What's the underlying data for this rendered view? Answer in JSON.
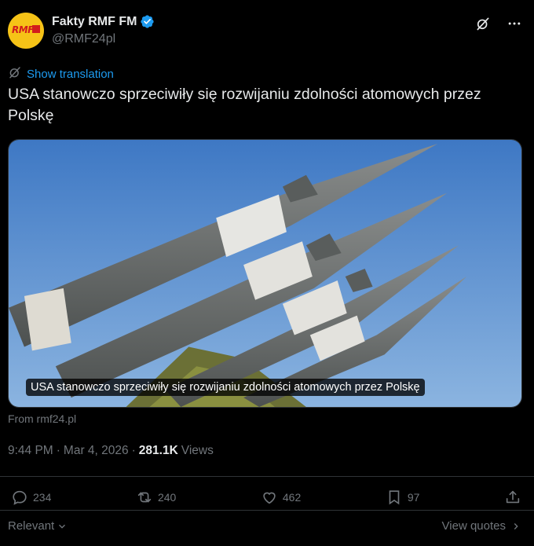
{
  "author": {
    "name": "Fakty RMF FM",
    "handle": "@RMF24pl",
    "avatar_text": "RMF"
  },
  "translate": {
    "label": "Show translation"
  },
  "tweet": {
    "text": "USA stanowczo sprzeciwiły się rozwijaniu zdolności atomowych przez Polskę"
  },
  "media": {
    "caption": "USA stanowczo sprzeciwiły się rozwijaniu zdolności atomowych przez Polskę"
  },
  "source": "From rmf24.pl",
  "meta": {
    "time": "9:44 PM",
    "separator": "·",
    "date": "Mar 4, 2026",
    "views_count": "281.1K",
    "views_label": "Views"
  },
  "actions": {
    "replies": "234",
    "reposts": "240",
    "likes": "462",
    "bookmarks": "97"
  },
  "footer": {
    "relevant": "Relevant",
    "view_quotes": "View quotes"
  },
  "colors": {
    "background": "#000000",
    "text": "#e7e9ea",
    "muted": "#71767b",
    "link": "#1d9bf0",
    "verified": "#1d9bf0",
    "avatar": "#f6c317"
  }
}
